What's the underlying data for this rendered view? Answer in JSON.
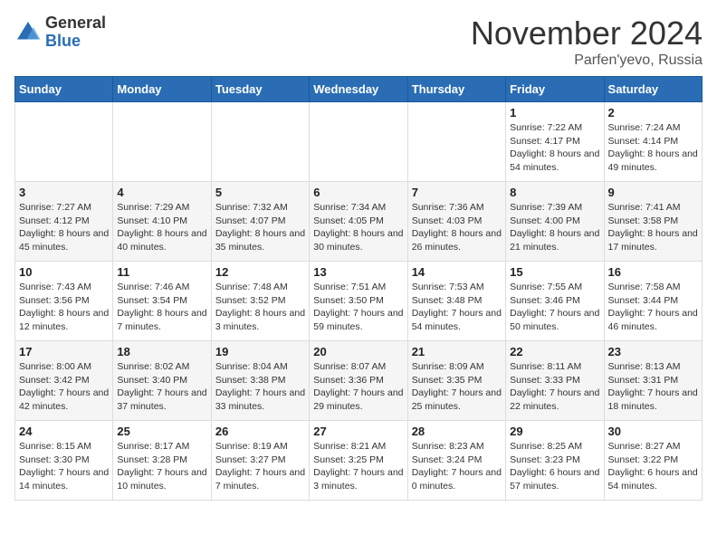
{
  "header": {
    "logo_general": "General",
    "logo_blue": "Blue",
    "month_title": "November 2024",
    "location": "Parfen'yevo, Russia"
  },
  "days_of_week": [
    "Sunday",
    "Monday",
    "Tuesday",
    "Wednesday",
    "Thursday",
    "Friday",
    "Saturday"
  ],
  "weeks": [
    [
      {
        "day": "",
        "info": ""
      },
      {
        "day": "",
        "info": ""
      },
      {
        "day": "",
        "info": ""
      },
      {
        "day": "",
        "info": ""
      },
      {
        "day": "",
        "info": ""
      },
      {
        "day": "1",
        "info": "Sunrise: 7:22 AM\nSunset: 4:17 PM\nDaylight: 8 hours and 54 minutes."
      },
      {
        "day": "2",
        "info": "Sunrise: 7:24 AM\nSunset: 4:14 PM\nDaylight: 8 hours and 49 minutes."
      }
    ],
    [
      {
        "day": "3",
        "info": "Sunrise: 7:27 AM\nSunset: 4:12 PM\nDaylight: 8 hours and 45 minutes."
      },
      {
        "day": "4",
        "info": "Sunrise: 7:29 AM\nSunset: 4:10 PM\nDaylight: 8 hours and 40 minutes."
      },
      {
        "day": "5",
        "info": "Sunrise: 7:32 AM\nSunset: 4:07 PM\nDaylight: 8 hours and 35 minutes."
      },
      {
        "day": "6",
        "info": "Sunrise: 7:34 AM\nSunset: 4:05 PM\nDaylight: 8 hours and 30 minutes."
      },
      {
        "day": "7",
        "info": "Sunrise: 7:36 AM\nSunset: 4:03 PM\nDaylight: 8 hours and 26 minutes."
      },
      {
        "day": "8",
        "info": "Sunrise: 7:39 AM\nSunset: 4:00 PM\nDaylight: 8 hours and 21 minutes."
      },
      {
        "day": "9",
        "info": "Sunrise: 7:41 AM\nSunset: 3:58 PM\nDaylight: 8 hours and 17 minutes."
      }
    ],
    [
      {
        "day": "10",
        "info": "Sunrise: 7:43 AM\nSunset: 3:56 PM\nDaylight: 8 hours and 12 minutes."
      },
      {
        "day": "11",
        "info": "Sunrise: 7:46 AM\nSunset: 3:54 PM\nDaylight: 8 hours and 7 minutes."
      },
      {
        "day": "12",
        "info": "Sunrise: 7:48 AM\nSunset: 3:52 PM\nDaylight: 8 hours and 3 minutes."
      },
      {
        "day": "13",
        "info": "Sunrise: 7:51 AM\nSunset: 3:50 PM\nDaylight: 7 hours and 59 minutes."
      },
      {
        "day": "14",
        "info": "Sunrise: 7:53 AM\nSunset: 3:48 PM\nDaylight: 7 hours and 54 minutes."
      },
      {
        "day": "15",
        "info": "Sunrise: 7:55 AM\nSunset: 3:46 PM\nDaylight: 7 hours and 50 minutes."
      },
      {
        "day": "16",
        "info": "Sunrise: 7:58 AM\nSunset: 3:44 PM\nDaylight: 7 hours and 46 minutes."
      }
    ],
    [
      {
        "day": "17",
        "info": "Sunrise: 8:00 AM\nSunset: 3:42 PM\nDaylight: 7 hours and 42 minutes."
      },
      {
        "day": "18",
        "info": "Sunrise: 8:02 AM\nSunset: 3:40 PM\nDaylight: 7 hours and 37 minutes."
      },
      {
        "day": "19",
        "info": "Sunrise: 8:04 AM\nSunset: 3:38 PM\nDaylight: 7 hours and 33 minutes."
      },
      {
        "day": "20",
        "info": "Sunrise: 8:07 AM\nSunset: 3:36 PM\nDaylight: 7 hours and 29 minutes."
      },
      {
        "day": "21",
        "info": "Sunrise: 8:09 AM\nSunset: 3:35 PM\nDaylight: 7 hours and 25 minutes."
      },
      {
        "day": "22",
        "info": "Sunrise: 8:11 AM\nSunset: 3:33 PM\nDaylight: 7 hours and 22 minutes."
      },
      {
        "day": "23",
        "info": "Sunrise: 8:13 AM\nSunset: 3:31 PM\nDaylight: 7 hours and 18 minutes."
      }
    ],
    [
      {
        "day": "24",
        "info": "Sunrise: 8:15 AM\nSunset: 3:30 PM\nDaylight: 7 hours and 14 minutes."
      },
      {
        "day": "25",
        "info": "Sunrise: 8:17 AM\nSunset: 3:28 PM\nDaylight: 7 hours and 10 minutes."
      },
      {
        "day": "26",
        "info": "Sunrise: 8:19 AM\nSunset: 3:27 PM\nDaylight: 7 hours and 7 minutes."
      },
      {
        "day": "27",
        "info": "Sunrise: 8:21 AM\nSunset: 3:25 PM\nDaylight: 7 hours and 3 minutes."
      },
      {
        "day": "28",
        "info": "Sunrise: 8:23 AM\nSunset: 3:24 PM\nDaylight: 7 hours and 0 minutes."
      },
      {
        "day": "29",
        "info": "Sunrise: 8:25 AM\nSunset: 3:23 PM\nDaylight: 6 hours and 57 minutes."
      },
      {
        "day": "30",
        "info": "Sunrise: 8:27 AM\nSunset: 3:22 PM\nDaylight: 6 hours and 54 minutes."
      }
    ]
  ]
}
